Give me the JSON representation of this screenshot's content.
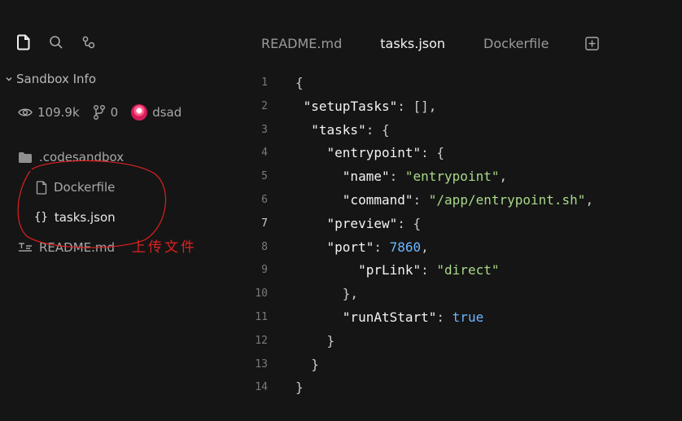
{
  "sidebar": {
    "top_icons": [
      "file-icon",
      "search-icon",
      "git-graph-icon"
    ],
    "section_title": "Sandbox Info",
    "views": "109.9k",
    "forks": "0",
    "username": "dsad",
    "tree": [
      {
        "label": ".codesandbox",
        "icon": "folder-icon"
      },
      {
        "label": "Dockerfile",
        "icon": "file-icon"
      },
      {
        "label": "tasks.json",
        "icon": "braces-icon"
      },
      {
        "label": "README.md",
        "icon": "markdown-icon"
      }
    ]
  },
  "annotation": {
    "text": "上传文件",
    "color": "#e02020"
  },
  "tabs": [
    {
      "label": "README.md",
      "active": false
    },
    {
      "label": "tasks.json",
      "active": true
    },
    {
      "label": "Dockerfile",
      "active": false
    }
  ],
  "editor": {
    "current_line": 7,
    "line_numbers": [
      "1",
      "2",
      "3",
      "4",
      "5",
      "6",
      "7",
      "8",
      "9",
      "10",
      "11",
      "12",
      "13",
      "14"
    ],
    "lines": [
      "{",
      " \"setupTasks\": [],",
      "  \"tasks\": {",
      "    \"entrypoint\": {",
      "      \"name\": \"entrypoint\",",
      "      \"command\": \"/app/entrypoint.sh\",",
      "    \"preview\": {",
      "    \"port\": 7860,",
      "        \"prLink\": \"direct\"",
      "      },",
      "      \"runAtStart\": true",
      "    }",
      "  }",
      "}"
    ]
  },
  "colors": {
    "background": "#151515",
    "string": "#a9d889",
    "number": "#6cb6ff",
    "annotation": "#e02020"
  }
}
